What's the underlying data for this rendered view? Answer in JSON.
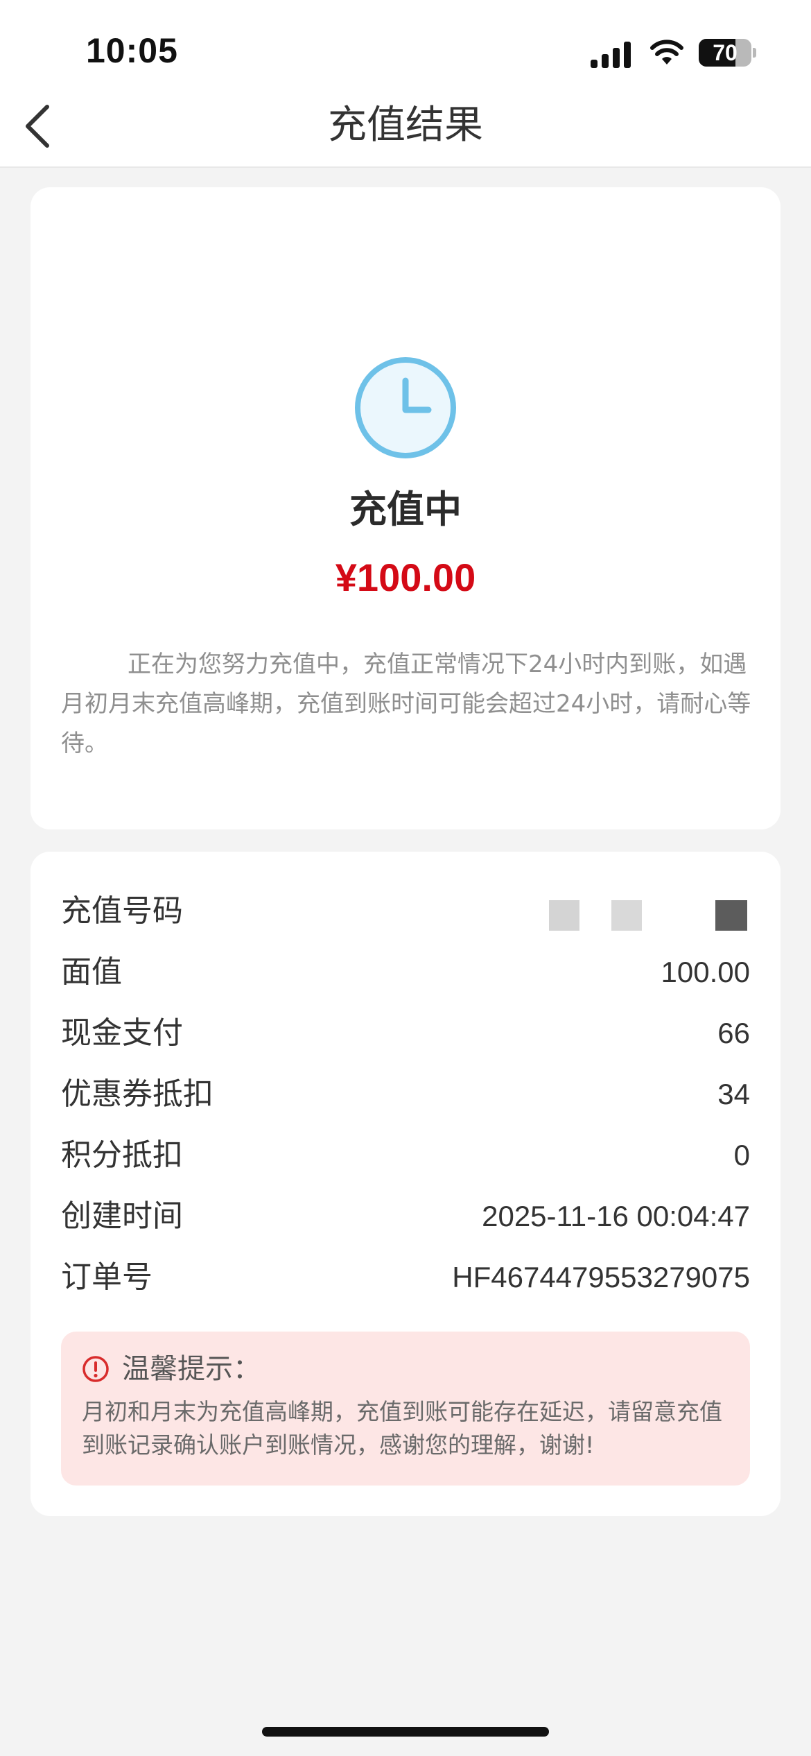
{
  "status_bar": {
    "time": "10:05",
    "battery_level": "70",
    "icons": [
      "signal-icon",
      "wifi-icon",
      "battery-icon"
    ]
  },
  "nav": {
    "title": "充值结果",
    "back_icon": "chevron-left-icon"
  },
  "result": {
    "icon": "clock-icon",
    "status": "充值中",
    "amount": "¥100.00",
    "notice": "正在为您努力充值中，充值正常情况下24小时内到账，如遇月初月末充值高峰期，充值到账时间可能会超过24小时，请耐心等待。"
  },
  "details": {
    "rows": [
      {
        "label": "充值号码",
        "value": ""
      },
      {
        "label": "面值",
        "value": "100.00"
      },
      {
        "label": "现金支付",
        "value": "66"
      },
      {
        "label": "优惠券抵扣",
        "value": "34"
      },
      {
        "label": "积分抵扣",
        "value": "0"
      },
      {
        "label": "创建时间",
        "value": "2025-11-16 00:04:47"
      },
      {
        "label": "订单号",
        "value": "HF4674479553279075"
      }
    ]
  },
  "tip": {
    "icon": "alert-circle-icon",
    "title": "温馨提示：",
    "text": "月初和月末为充值高峰期，充值到账可能存在延迟，请留意充值到账记录确认账户到账情况，感谢您的理解，谢谢!"
  },
  "colors": {
    "accent_red": "#d40a16",
    "clock_blue": "#6ec1e8",
    "tip_background": "#fde6e5",
    "tip_icon_red": "#d82c2c"
  }
}
